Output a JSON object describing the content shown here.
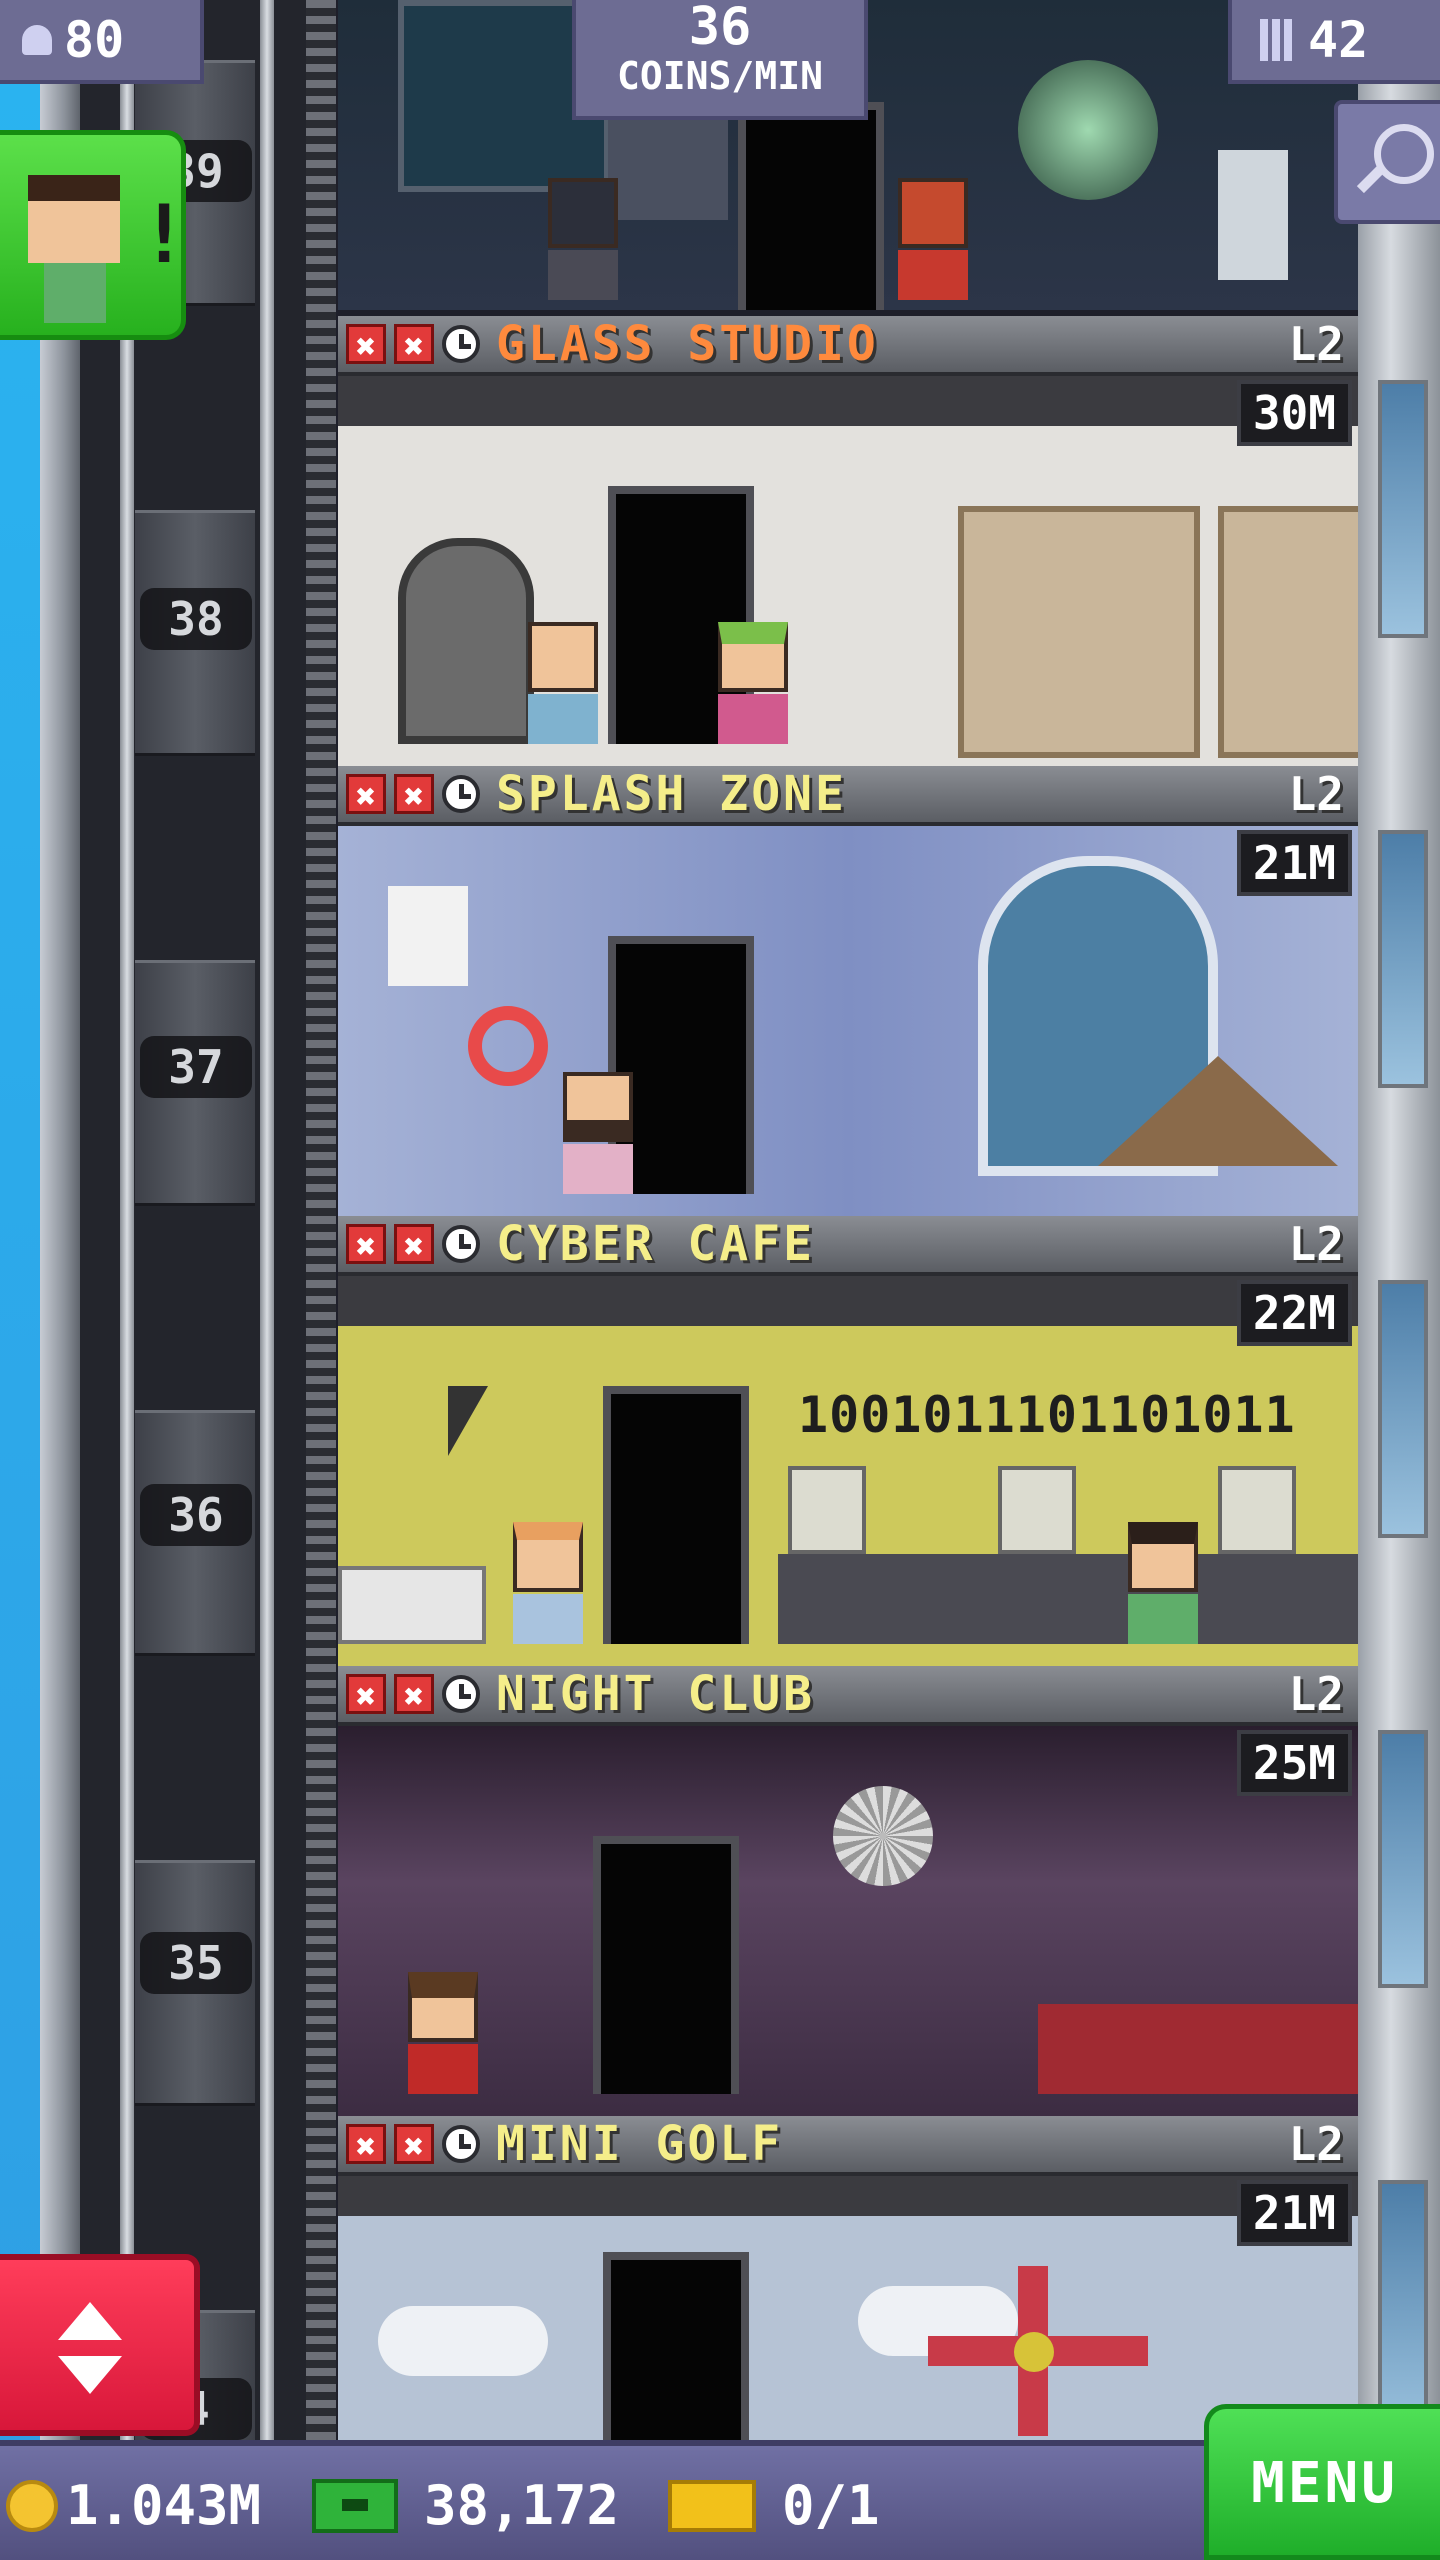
{
  "hud": {
    "population": "80",
    "coin_rate_value": "36",
    "coin_rate_unit": "COINS/MIN",
    "floors_count": "42"
  },
  "floor_numbers": {
    "top": "39",
    "f38": "38",
    "f37": "37",
    "f36": "36",
    "f35": "35",
    "bottom": "4"
  },
  "floors": [
    {
      "name": "GLASS STUDIO",
      "level": "L2",
      "stock": "30M",
      "status": "active"
    },
    {
      "name": "SPLASH ZONE",
      "level": "L2",
      "stock": "21M",
      "status": "normal"
    },
    {
      "name": "CYBER CAFE",
      "level": "L2",
      "stock": "22M",
      "status": "normal"
    },
    {
      "name": "NIGHT CLUB",
      "level": "L2",
      "stock": "25M",
      "status": "normal"
    },
    {
      "name": "MINI GOLF",
      "level": "L2",
      "stock": "21M",
      "status": "normal"
    }
  ],
  "cafe_binary": "1001011101101011",
  "x_mark": "✖",
  "notification_mark": "!",
  "bottom_bar": {
    "coins": "1.043M",
    "bux": "38,172",
    "tickets": "0/1",
    "menu_label": "MENU"
  },
  "colors": {
    "hud_bg": "#6d6c93",
    "active_floor_name": "#ff8a3d",
    "floor_name": "#f5ee8a",
    "menu_green": "#2fc43a",
    "elevator_red": "#e8253f"
  },
  "icons": [
    "person-icon",
    "building-icon",
    "search-icon",
    "x-icon",
    "clock-icon",
    "coin-icon",
    "bux-icon",
    "ticket-icon",
    "elevator-up-icon",
    "elevator-down-icon"
  ]
}
